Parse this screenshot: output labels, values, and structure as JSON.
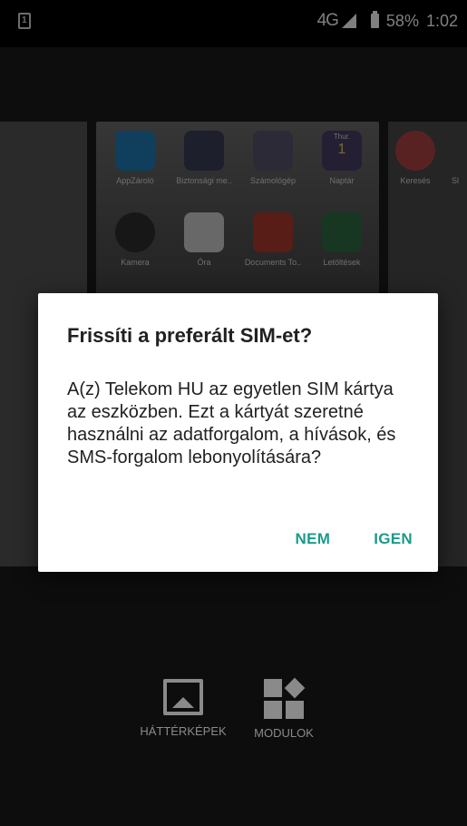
{
  "statusbar": {
    "sim_slot": "1",
    "network": "4G",
    "battery": "58%",
    "time": "1:02"
  },
  "launcher": {
    "apps_row1": [
      {
        "label": "AppZároló",
        "icon": "lock-app-icon",
        "color": "#1f7fb8"
      },
      {
        "label": "Biztonsági me..",
        "icon": "cloud-icon",
        "color": "#3a3f5a"
      },
      {
        "label": "Számológép",
        "icon": "calculator-icon",
        "color": "#5a5570"
      },
      {
        "label": "Naptár",
        "icon": "calendar-icon",
        "color": "#4b3f66"
      }
    ],
    "calendar_day": "Thur.",
    "calendar_date": "1",
    "apps_row2": [
      {
        "label": "Kamera",
        "icon": "camera-icon",
        "color": "#2e2e2e"
      },
      {
        "label": "Óra",
        "icon": "clock-icon",
        "color": "#d0d0d0"
      },
      {
        "label": "Documents To..",
        "icon": "documents-icon",
        "color": "#b23b2f"
      },
      {
        "label": "Letöltések",
        "icon": "download-icon",
        "color": "#2f6e46"
      }
    ],
    "right_app": {
      "label": "Keresés",
      "icon": "search-icon",
      "color": "#b24444"
    },
    "right_app_partial": "Sl"
  },
  "bottom": {
    "wallpapers_label": "HÁTTÉRKÉPEK",
    "modules_label": "MODULOK"
  },
  "dialog": {
    "title": "Frissíti a preferált SIM-et?",
    "message": "A(z) Telekom HU az egyetlen SIM kártya az eszközben. Ezt a kártyát szeretné használni az adatforgalom, a hívások, és SMS-forgalom lebonyolítására?",
    "negative": "NEM",
    "positive": "IGEN",
    "accent_color": "#1a9a8c"
  }
}
